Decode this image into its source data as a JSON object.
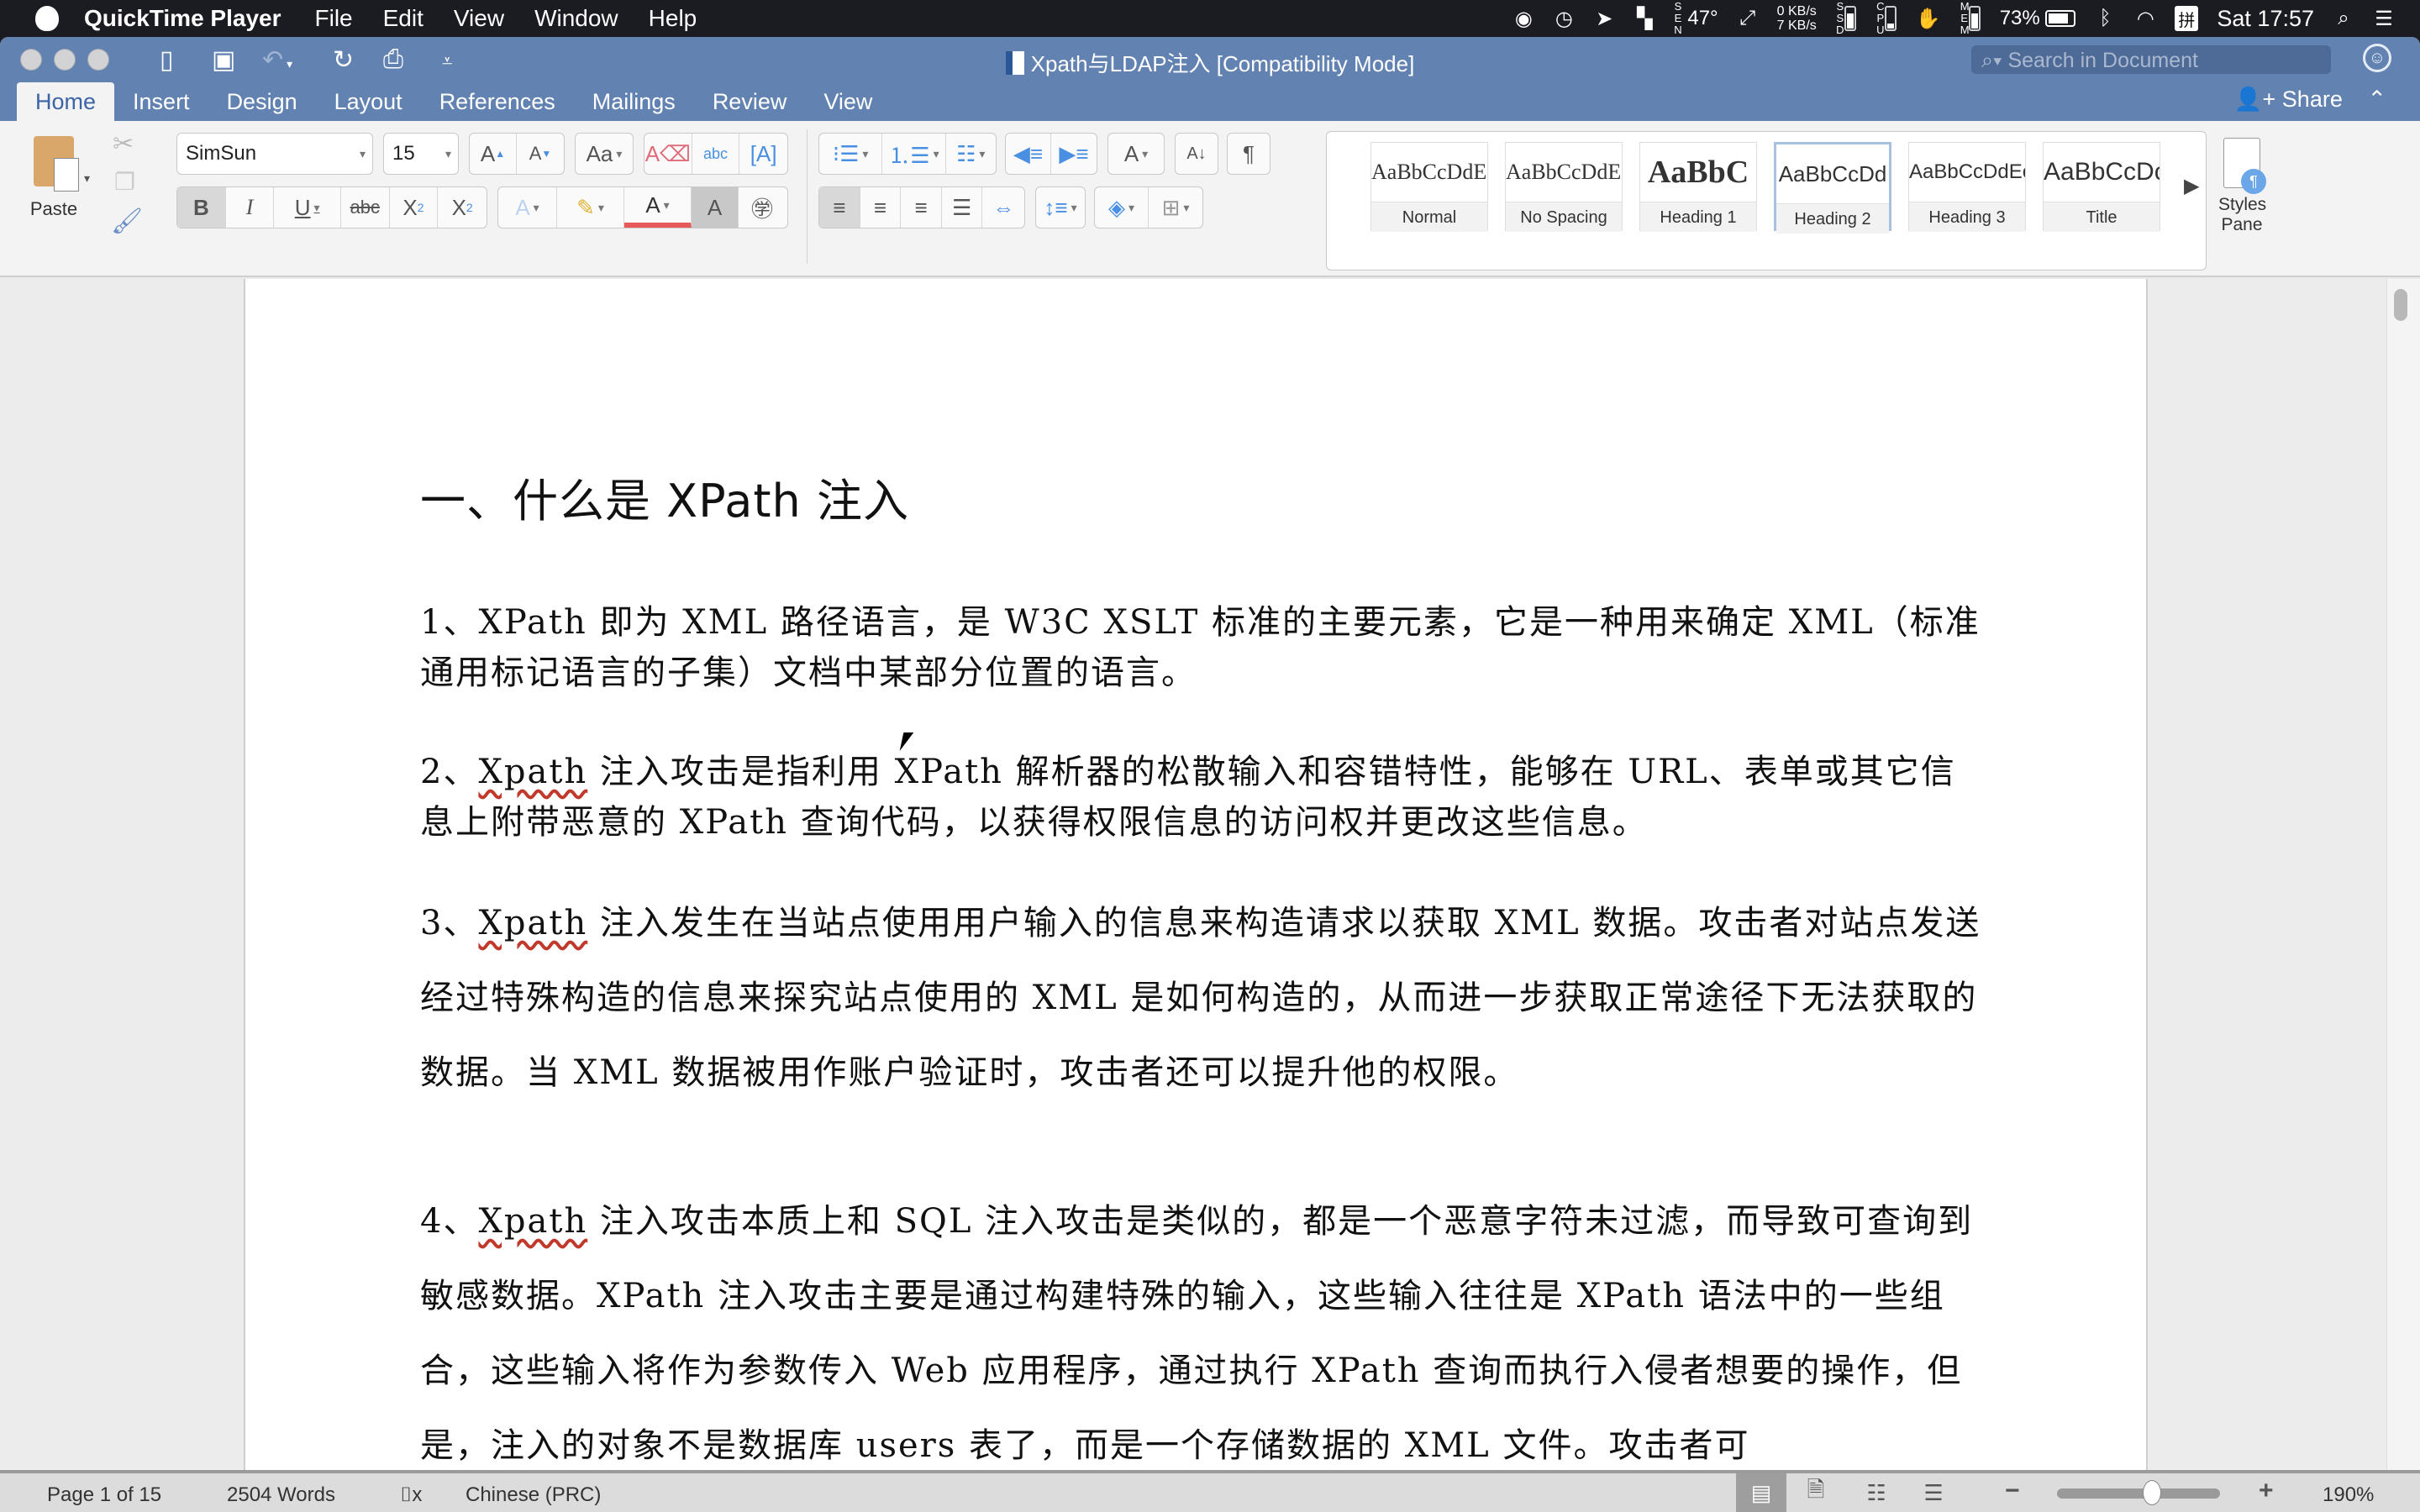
{
  "menubar": {
    "app_name": "QuickTime Player",
    "items": [
      "File",
      "Edit",
      "View",
      "Window",
      "Help"
    ],
    "tray": {
      "weather": "47°",
      "net_up": "0 KB/s",
      "net_down": "7 KB/s",
      "ssd_label": "SSD",
      "cpu_label": "CPU",
      "mem_label": "MEM",
      "battery": "73%",
      "input_method": "拼",
      "clock": "Sat 17:57"
    }
  },
  "window": {
    "title": "Xpath与LDAP注入 [Compatibility Mode]",
    "search_placeholder": "Search in Document",
    "tabs": [
      "Home",
      "Insert",
      "Design",
      "Layout",
      "References",
      "Mailings",
      "Review",
      "View"
    ],
    "active_tab": "Home",
    "share_label": "Share"
  },
  "ribbon": {
    "paste_label": "Paste",
    "font_name": "SimSun",
    "font_size": "15",
    "styles": [
      {
        "preview": "AaBbCcDdEe",
        "name": "Normal"
      },
      {
        "preview": "AaBbCcDdEe",
        "name": "No Spacing"
      },
      {
        "preview": "AaBbC",
        "name": "Heading 1"
      },
      {
        "preview": "AaBbCcDd",
        "name": "Heading 2"
      },
      {
        "preview": "AaBbCcDdEe",
        "name": "Heading 3"
      },
      {
        "preview": "AaBbCcDc",
        "name": "Title"
      }
    ],
    "selected_style": "Heading 2",
    "styles_pane_label_1": "Styles",
    "styles_pane_label_2": "Pane"
  },
  "document": {
    "heading": "一、什么是 XPath 注入",
    "p1": "1、XPath 即为 XML 路径语言，是 W3C XSLT 标准的主要元素，它是一种用来确定 XML（标准通用标记语言的子集）文档中某部分位置的语言。",
    "p2_num": "2、",
    "p2_word": "Xpath",
    "p2_rest": " 注入攻击是指利用 XPath 解析器的松散输入和容错特性，能够在 URL、表单或其它信息上附带恶意的 XPath 查询代码，以获得权限信息的访问权并更改这些信息。",
    "p3_num": "3、",
    "p3_word": "Xpath",
    "p3_rest": " 注入发生在当站点使用用户输入的信息来构造请求以获取 XML 数据。攻击者对站点发送经过特殊构造的信息来探究站点使用的 XML 是如何构造的，从而进一步获取正常途径下无法获取的数据。当 XML 数据被用作账户验证时，攻击者还可以提升他的权限。",
    "p4_num": "4、",
    "p4_word": "Xpath",
    "p4_rest": " 注入攻击本质上和 SQL 注入攻击是类似的，都是一个恶意字符未过滤，而导致可查询到敏感数据。XPath 注入攻击主要是通过构建特殊的输入，这些输入往往是 XPath 语法中的一些组合，这些输入将作为参数传入 Web 应用程序，通过执行 XPath 查询而执行入侵者想要的操作，但是，注入的对象不是数据库 users 表了，而是一个存储数据的 XML 文件。攻击者可"
  },
  "status": {
    "page": "Page 1 of 15",
    "words": "2504 Words",
    "language": "Chinese (PRC)",
    "zoom": "190%",
    "zoom_minus": "−",
    "zoom_plus": "+"
  }
}
